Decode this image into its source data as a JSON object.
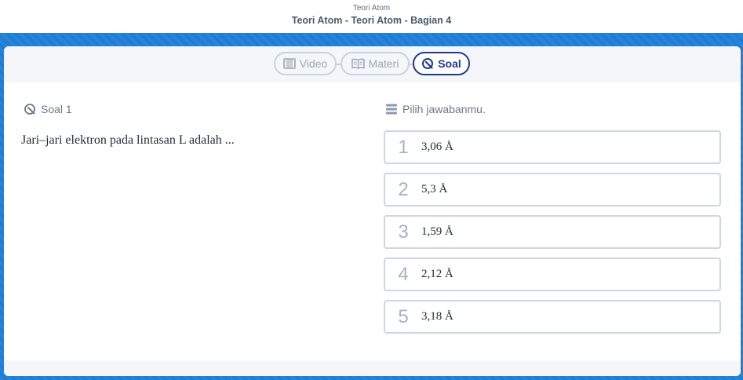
{
  "header": {
    "course": "Teori Atom",
    "lesson": "Teori Atom - Teori Atom - Bagian 4"
  },
  "tabs": [
    {
      "label": "Video",
      "icon": "film-icon",
      "active": false
    },
    {
      "label": "Materi",
      "icon": "book-icon",
      "active": false
    },
    {
      "label": "Soal",
      "icon": "quiz-icon",
      "active": true
    }
  ],
  "question": {
    "label": "Soal 1",
    "text": "Jari–jari elektron pada lintasan L adalah ..."
  },
  "answers": {
    "prompt": "Pilih jawabanmu.",
    "options": [
      {
        "num": "1",
        "text": "3,06 Å"
      },
      {
        "num": "2",
        "text": "5,3 Å"
      },
      {
        "num": "3",
        "text": "1,59 Å"
      },
      {
        "num": "4",
        "text": "2,12 Å"
      },
      {
        "num": "5",
        "text": "3,18 Å"
      }
    ]
  },
  "colors": {
    "accent": "#1e3a8a",
    "band": "#1e7fd8",
    "border": "#ccd7e3"
  }
}
